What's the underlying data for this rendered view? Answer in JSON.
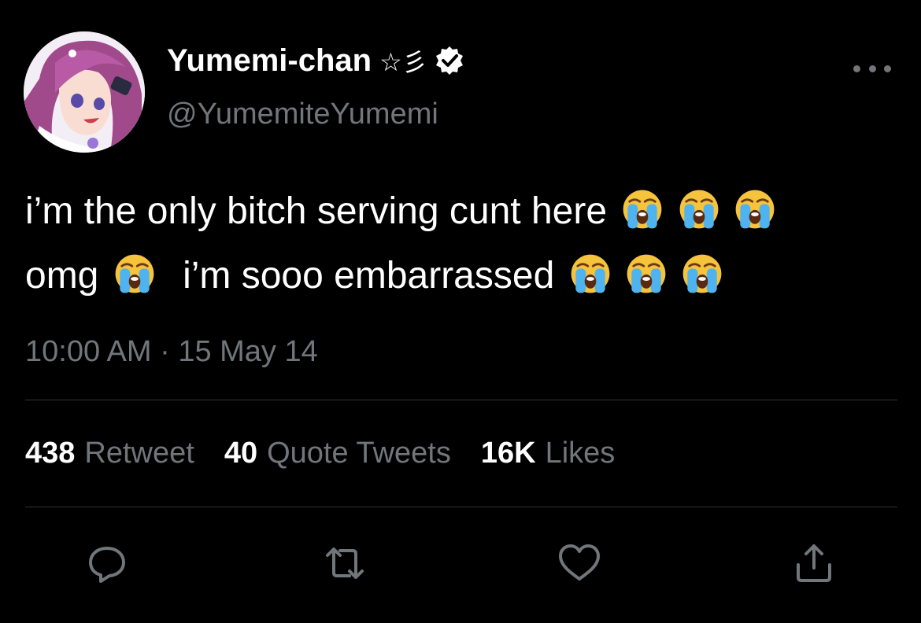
{
  "user": {
    "display_name": "Yumemi-chan",
    "name_symbols": "☆彡",
    "handle": "@YumemiteYumemi",
    "verified": true
  },
  "tweet": {
    "line1": "i’m the only bitch serving cunt here",
    "line1_emoji_count": 3,
    "line2_start": "omg",
    "line2_middle": "i’m sooo embarrassed",
    "line2_end_emoji_count": 3,
    "emoji_name": "loudly-crying-face",
    "timestamp": "10:00 AM · 15 May 14"
  },
  "stats": {
    "retweets_count": "438",
    "retweets_label": "Retweet",
    "quotes_count": "40",
    "quotes_label": "Quote Tweets",
    "likes_count": "16K",
    "likes_label": "Likes"
  },
  "actions": [
    "reply-icon",
    "retweet-icon",
    "like-icon",
    "share-icon"
  ],
  "colors": {
    "background": "#000000",
    "text_primary": "#ffffff",
    "text_secondary": "#71767b",
    "divider": "#2f3336"
  }
}
